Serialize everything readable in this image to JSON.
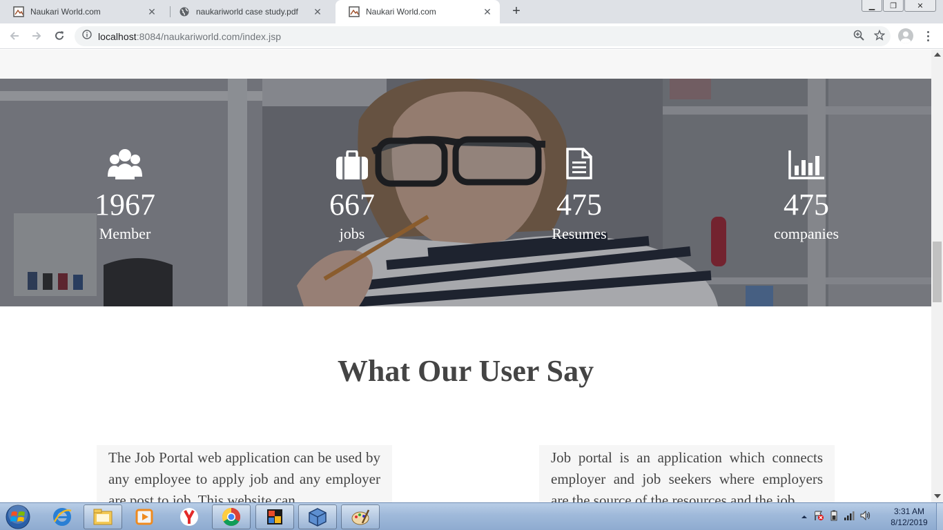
{
  "browser": {
    "tabs": [
      {
        "title": "Naukari World.com",
        "icon": "site-favicon",
        "active": false
      },
      {
        "title": "naukariworld case study.pdf",
        "icon": "globe-icon",
        "active": false
      },
      {
        "title": "Naukari World.com",
        "icon": "site-favicon",
        "active": true
      }
    ],
    "new_tab_label": "+",
    "url_host": "localhost",
    "url_rest": ":8084/naukariworld.com/index.jsp"
  },
  "page": {
    "stats": [
      {
        "icon": "users-icon",
        "number": "1967",
        "label": "Member"
      },
      {
        "icon": "briefcase-icon",
        "number": "667",
        "label": "jobs"
      },
      {
        "icon": "document-icon",
        "number": "475",
        "label": "Resumes"
      },
      {
        "icon": "bar-chart-icon",
        "number": "475",
        "label": "companies"
      }
    ],
    "section_title": "What Our User Say",
    "testimonials": [
      {
        "text": "The Job Portal web application can be used by any employee to apply job and any employer are post to job. This website can"
      },
      {
        "text": "Job portal is an application which connects employer and job seekers where employers are the source of the resources and the job"
      }
    ]
  },
  "taskbar": {
    "apps": [
      "internet-explorer-icon",
      "file-explorer-icon",
      "media-player-icon",
      "yandex-icon",
      "chrome-icon",
      "ms-office-icon",
      "virtualbox-icon",
      "paint-icon"
    ],
    "time": "3:31 AM",
    "date": "8/12/2019"
  },
  "colors": {
    "tabstrip": "#dee1e6",
    "taskbar": "#9fb9da",
    "title_text": "#444444"
  }
}
